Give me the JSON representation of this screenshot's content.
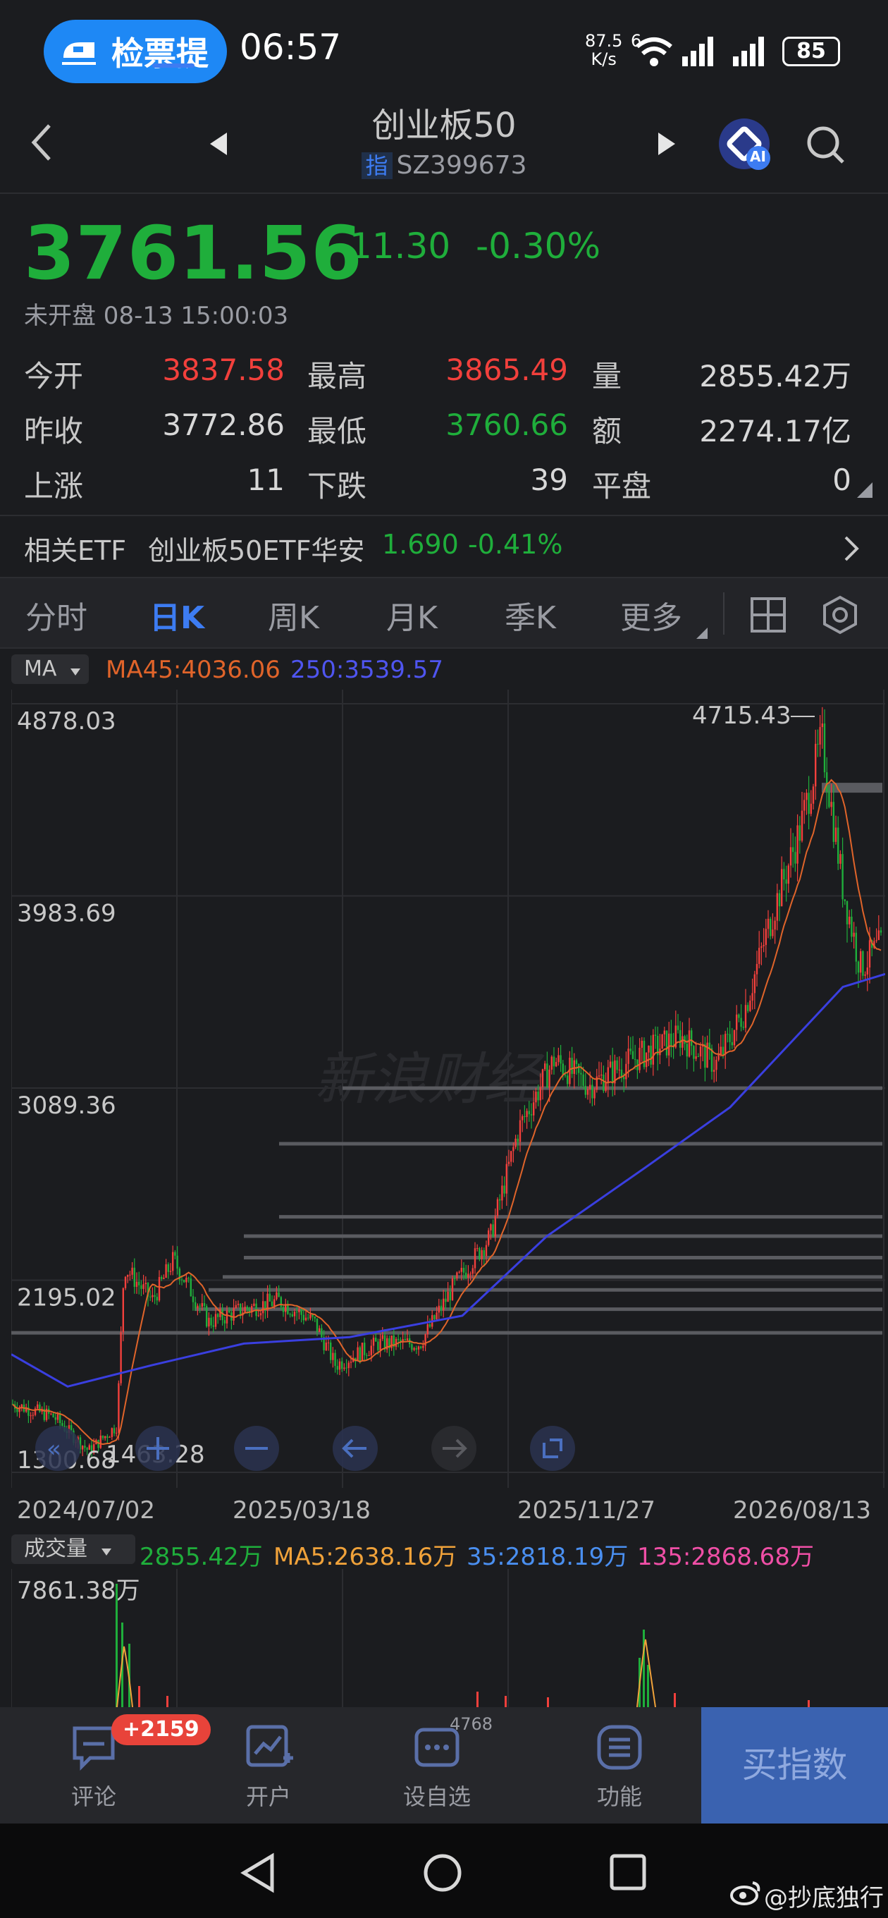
{
  "status_bar": {
    "app_pill": "检票提",
    "time": "06:57",
    "net_speed": "87.5",
    "net_unit": "K/s",
    "sim": "6",
    "battery": "85"
  },
  "header": {
    "title": "创业板50",
    "index_tag": "指",
    "code": "SZ399673",
    "ai_badge": "AI"
  },
  "quote": {
    "price": "3761.56",
    "change": "-11.30",
    "change_pct": "-0.30%",
    "status_time": "未开盘 08-13 15:00:03"
  },
  "stats": [
    {
      "l1": "今开",
      "v1": "3837.58",
      "l2": "最高",
      "v2": "3865.49",
      "l3": "量",
      "v3": "2855.42万"
    },
    {
      "l1": "昨收",
      "v1": "3772.86",
      "l2": "最低",
      "v2": "3760.66",
      "l3": "额",
      "v3": "2274.17亿"
    },
    {
      "l1": "上涨",
      "v1": "11",
      "l2": "下跌",
      "v2": "39",
      "l3": "平盘",
      "v3": "0"
    }
  ],
  "etf": {
    "label": "相关ETF",
    "name": "创业板50ETF华安",
    "price": "1.690",
    "pct": "-0.41%"
  },
  "tabs": [
    "分时",
    "日K",
    "周K",
    "月K",
    "季K",
    "更多"
  ],
  "ma": {
    "selector": "MA",
    "ma45": "MA45:4036.06",
    "ma250": "250:3539.57"
  },
  "chart": {
    "y_labels": [
      "4878.03",
      "3983.69",
      "3089.36",
      "2195.02",
      "1300.68"
    ],
    "high_label": "4715.43",
    "low_label": "1463.28",
    "watermark": "新浪财经",
    "x_labels": [
      "2024/07/02",
      "2025/03/18",
      "2025/11/27",
      "2026/08/13"
    ]
  },
  "chart_data": {
    "type": "candlestick",
    "ylim": [
      1300.68,
      4878.03
    ],
    "y_ticks": [
      4878.03,
      3983.69,
      3089.36,
      2195.02,
      1300.68
    ],
    "x_ticks": [
      "2024/07/02",
      "2025/03/18",
      "2025/11/27",
      "2026/08/13"
    ],
    "annotations": {
      "high": 4715.43,
      "low": 1463.28
    },
    "series": [
      {
        "name": "MA45",
        "last": 4036.06
      },
      {
        "name": "250",
        "last": 3539.57
      }
    ]
  },
  "volume": {
    "selector": "成交量",
    "vol": "2855.42万",
    "ma5": "MA5:2638.16万",
    "ma35": "35:2818.19万",
    "ma135": "135:2868.68万",
    "y_label": "7861.38万"
  },
  "bottom_nav": {
    "comment": "评论",
    "badge": "+2159",
    "open": "开户",
    "watch": "设自选",
    "watch_count": "4768",
    "func": "功能",
    "buy": "买指数"
  },
  "watermark_user": "@抄底独行",
  "colors": {
    "up": "#f2403c",
    "down": "#1fae3b",
    "accent": "#3d7cf2",
    "ma45": "#e0642a",
    "ma250": "#3a3fe0"
  }
}
